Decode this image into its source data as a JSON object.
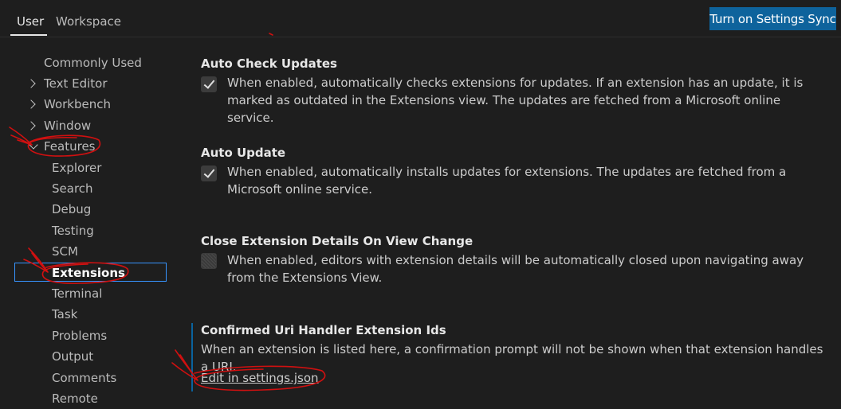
{
  "header": {
    "tabs": [
      {
        "label": "User",
        "active": true
      },
      {
        "label": "Workspace",
        "active": false
      }
    ],
    "sync_button_label": "Turn on Settings Sync"
  },
  "toc": {
    "items": [
      {
        "label": "Commonly Used"
      },
      {
        "label": "Text Editor",
        "chevron": "right"
      },
      {
        "label": "Workbench",
        "chevron": "right"
      },
      {
        "label": "Window",
        "chevron": "right"
      },
      {
        "label": "Features",
        "chevron": "down"
      },
      {
        "label": "Explorer"
      },
      {
        "label": "Search"
      },
      {
        "label": "Debug"
      },
      {
        "label": "Testing"
      },
      {
        "label": "SCM"
      },
      {
        "label": "Extensions",
        "selected": true
      },
      {
        "label": "Terminal"
      },
      {
        "label": "Task"
      },
      {
        "label": "Problems"
      },
      {
        "label": "Output"
      },
      {
        "label": "Comments"
      },
      {
        "label": "Remote"
      }
    ]
  },
  "settings": [
    {
      "title": "Auto Check Updates",
      "checked": true,
      "description": "When enabled, automatically checks extensions for updates. If an extension has an update, it is marked as outdated in the Extensions view. The updates are fetched from a Microsoft online service."
    },
    {
      "title": "Auto Update",
      "checked": true,
      "description": "When enabled, automatically installs updates for extensions. The updates are fetched from a Microsoft online service."
    },
    {
      "title": "Close Extension Details On View Change",
      "checked": false,
      "description": "When enabled, editors with extension details will be automatically closed upon navigating away from the Extensions View."
    },
    {
      "title": "Confirmed Uri Handler Extension Ids",
      "description": "When an extension is listed here, a confirmation prompt will not be shown when that extension handles a URI.",
      "link_label": "Edit in settings.json"
    }
  ],
  "colors": {
    "background": "#1e1e1e",
    "accent_button": "#0e639c",
    "focus_border": "#3794ff",
    "annotation": "#d01010"
  }
}
